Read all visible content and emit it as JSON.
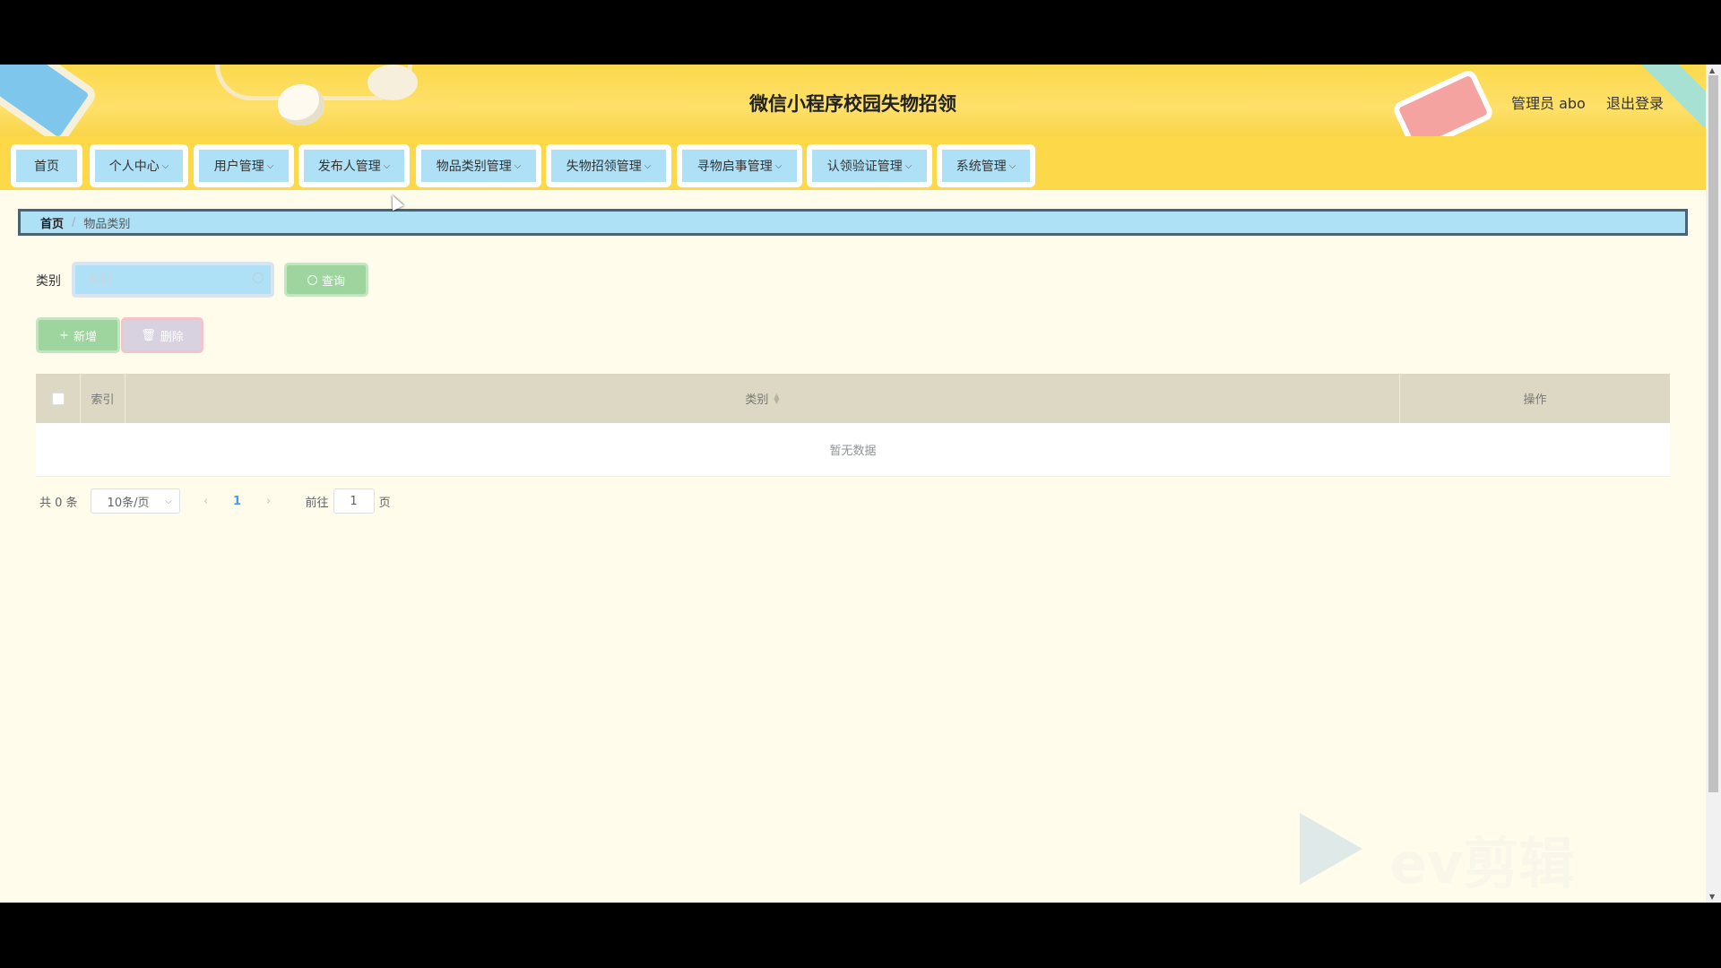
{
  "header": {
    "title": "微信小程序校园失物招领",
    "admin": "管理员 abo",
    "logout": "退出登录"
  },
  "nav": {
    "items": [
      {
        "label": "首页",
        "has_dropdown": false
      },
      {
        "label": "个人中心",
        "has_dropdown": true
      },
      {
        "label": "用户管理",
        "has_dropdown": true
      },
      {
        "label": "发布人管理",
        "has_dropdown": true
      },
      {
        "label": "物品类别管理",
        "has_dropdown": true
      },
      {
        "label": "失物招领管理",
        "has_dropdown": true
      },
      {
        "label": "寻物启事管理",
        "has_dropdown": true
      },
      {
        "label": "认领验证管理",
        "has_dropdown": true
      },
      {
        "label": "系统管理",
        "has_dropdown": true
      }
    ],
    "chevron": "⌵"
  },
  "breadcrumb": {
    "home": "首页",
    "separator": "/",
    "current": "物品类别"
  },
  "search": {
    "label": "类别",
    "placeholder": "类别",
    "button": "查询"
  },
  "actions": {
    "add": "新增",
    "add_icon": "+",
    "delete": "删除",
    "delete_icon": "🗑"
  },
  "table": {
    "columns": {
      "index": "索引",
      "category": "类别",
      "operations": "操作"
    },
    "empty_text": "暂无数据"
  },
  "pagination": {
    "total": "共 0 条",
    "page_size": "10条/页",
    "current_page": "1",
    "goto_label": "前往",
    "goto_value": "1",
    "goto_suffix": "页"
  },
  "watermark": {
    "text": "ev剪辑"
  },
  "colors": {
    "header_yellow": "#fdd94a",
    "nav_button_blue": "#aee0f6",
    "page_bg": "#fffcec",
    "table_header": "#dcd8c3",
    "success_green": "#9ed59e"
  }
}
